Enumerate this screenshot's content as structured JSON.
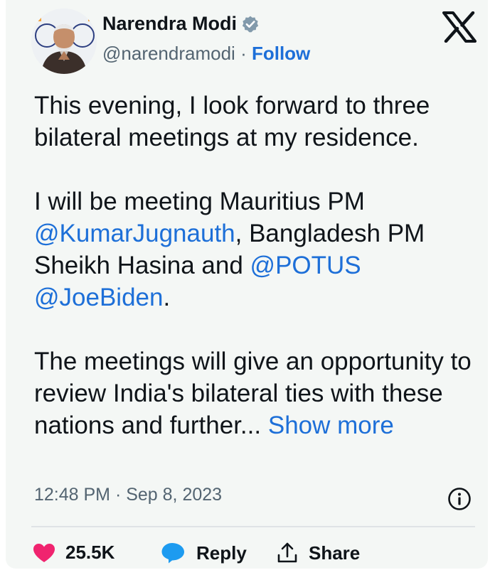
{
  "author": {
    "name": "Narendra Modi",
    "handle": "@narendramodi",
    "separator": "·",
    "follow_label": "Follow"
  },
  "tweet": {
    "paragraph1": "This evening, I look forward to three bilateral meetings at my residence.",
    "p2_part1": "I will be meeting Mauritius PM ",
    "mention1": "@KumarJugnauth",
    "p2_part2": ", Bangladesh PM Sheikh Hasina and ",
    "mention2": "@POTUS",
    "p2_space": " ",
    "mention3": "@JoeBiden",
    "p2_end": ".",
    "paragraph3": "The meetings will give an opportunity to review India's bilateral ties with these nations and further...",
    "show_more_label": "Show more"
  },
  "meta": {
    "timestamp": "12:48 PM · Sep 8, 2023"
  },
  "actions": {
    "likes": "25.5K",
    "reply_label": "Reply",
    "share_label": "Share"
  },
  "colors": {
    "link": "#1d6fd8",
    "like": "#f0246f",
    "reply": "#1d9bf0",
    "verified": "#829aab"
  },
  "icons": [
    "verified-badge-icon",
    "x-logo-icon",
    "info-icon",
    "heart-icon",
    "reply-bubble-icon",
    "share-icon"
  ]
}
